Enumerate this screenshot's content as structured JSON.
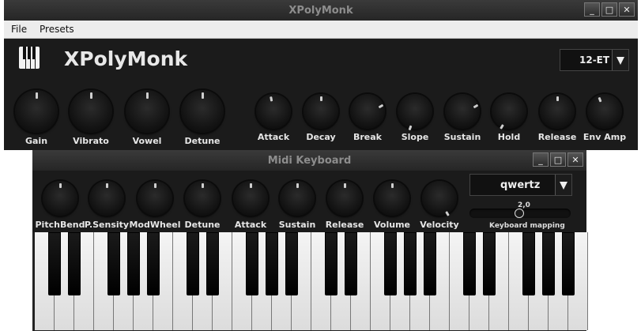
{
  "main_window": {
    "title": "XPolyMonk",
    "window_buttons": [
      "_",
      "□",
      "✕"
    ],
    "menu": [
      "File",
      "Presets"
    ],
    "brand": "XPolyMonk",
    "tuning": {
      "value": "12-ET"
    },
    "knobs": [
      {
        "label": "Gain"
      },
      {
        "label": "Vibrato"
      },
      {
        "label": "Vowel"
      },
      {
        "label": "Detune"
      },
      {
        "label": "Attack"
      },
      {
        "label": "Decay"
      },
      {
        "label": "Break"
      },
      {
        "label": "Slope"
      },
      {
        "label": "Sustain"
      },
      {
        "label": "Hold"
      },
      {
        "label": "Release"
      },
      {
        "label": "Env Amp"
      }
    ]
  },
  "midi_window": {
    "title": "Midi Keyboard",
    "window_buttons": [
      "_",
      "□",
      "✕"
    ],
    "layout": {
      "value": "qwertz"
    },
    "mapping": {
      "value": "2,0",
      "label": "Keyboard mapping"
    },
    "knobs": [
      {
        "label": "PitchBend"
      },
      {
        "label": "P.Sensity"
      },
      {
        "label": "ModWheel"
      },
      {
        "label": "Detune"
      },
      {
        "label": "Attack"
      },
      {
        "label": "Sustain"
      },
      {
        "label": "Release"
      },
      {
        "label": "Volume"
      },
      {
        "label": "Velocity"
      }
    ]
  },
  "colors": {
    "knob_tick": "#cfcfcf",
    "panel": "#1b1b1b",
    "titlebar": "#2d2d2d"
  },
  "icons": {
    "brand": "piano-keys-icon",
    "dropdown": "chevron-down-icon"
  }
}
